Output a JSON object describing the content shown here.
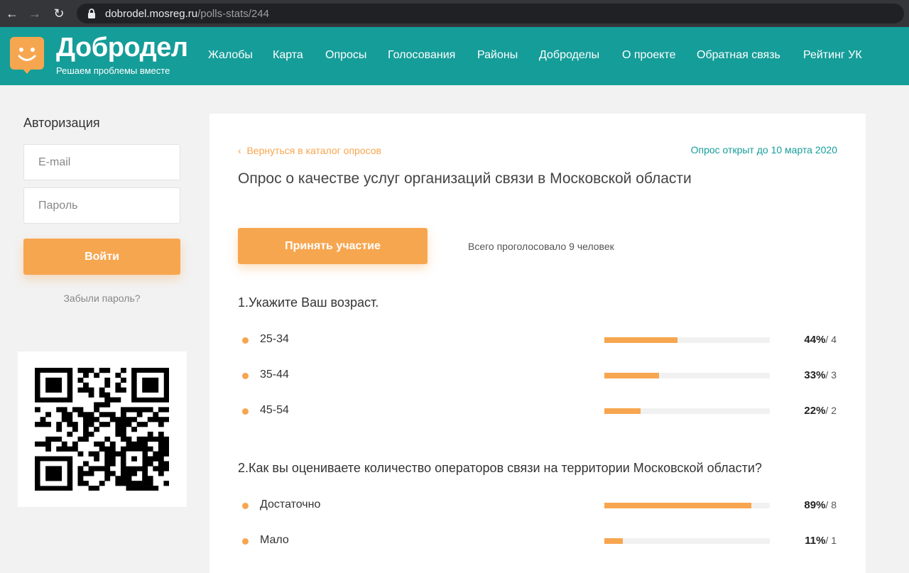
{
  "browser": {
    "back_glyph": "←",
    "forward_glyph": "→",
    "reload_glyph": "↻",
    "url_domain": "dobrodel.mosreg.ru",
    "url_path": "/polls-stats/244"
  },
  "header": {
    "logo_title": "Добродел",
    "logo_subtitle": "Решаем проблемы вместе",
    "brand_color": "#159d99",
    "nav": [
      "Жалобы",
      "Карта",
      "Опросы",
      "Голосования",
      "Районы",
      "Доброделы",
      "О проекте",
      "Обратная связь",
      "Рейтинг УК"
    ]
  },
  "auth": {
    "title": "Авторизация",
    "email_placeholder": "E-mail",
    "password_placeholder": "Пароль",
    "login_label": "Войти",
    "forgot_label": "Забыли пароль?"
  },
  "poll": {
    "back_label": "Вернуться в каталог опросов",
    "back_icon": "‹",
    "open_until": "Опрос открыт до 10 марта 2020",
    "title": "Опрос о качестве услуг организаций связи в Московской области",
    "participate_label": "Принять участие",
    "total_votes": "Всего проголосовало 9 человек",
    "accent_color": "#f7a650",
    "questions": [
      {
        "text": "1.Укажите Ваш возраст.",
        "answers": [
          {
            "label": "25-34",
            "percent": "44%",
            "count": "/ 4",
            "fraction": 0.44
          },
          {
            "label": "35-44",
            "percent": "33%",
            "count": "/ 3",
            "fraction": 0.33
          },
          {
            "label": "45-54",
            "percent": "22%",
            "count": "/ 2",
            "fraction": 0.22
          }
        ]
      },
      {
        "text": "2.Как вы оцениваете количество операторов связи на территории Московской области?",
        "answers": [
          {
            "label": "Достаточно",
            "percent": "89%",
            "count": "/ 8",
            "fraction": 0.89
          },
          {
            "label": "Мало",
            "percent": "11%",
            "count": "/ 1",
            "fraction": 0.11
          }
        ]
      }
    ]
  }
}
